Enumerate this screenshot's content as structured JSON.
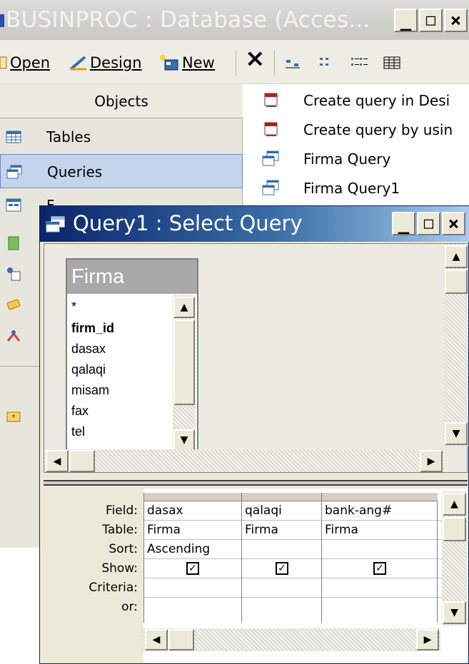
{
  "db_window": {
    "title": "BUSINPROC : Database (Acces...",
    "caption_buttons": [
      "_",
      "□",
      "×"
    ],
    "toolbar": {
      "open": "Open",
      "design": "Design",
      "new": "New",
      "delete_glyph": "×"
    },
    "objects_header": "Objects",
    "objects": [
      {
        "label": "Tables",
        "icon": "table-icon"
      },
      {
        "label": "Queries",
        "icon": "query-icon",
        "selected": true
      },
      {
        "label": "F",
        "icon": "form-icon"
      }
    ],
    "list": [
      {
        "label": "Create query in Desi",
        "icon": "wizard-icon"
      },
      {
        "label": "Create query by usin",
        "icon": "wizard-icon"
      },
      {
        "label": "Firma Query",
        "icon": "query-icon"
      },
      {
        "label": "Firma Query1",
        "icon": "query-icon"
      }
    ]
  },
  "query_window": {
    "title": "Query1 : Select Query",
    "caption_buttons": [
      "_",
      "□",
      "×"
    ],
    "table_box": {
      "name": "Firma",
      "fields": [
        "*",
        "firm_id",
        "dasax",
        "qalaqi",
        "misam",
        "fax",
        "tel"
      ],
      "bold_field": "firm_id"
    },
    "grid": {
      "row_labels": [
        "Field:",
        "Table:",
        "Sort:",
        "Show:",
        "Criteria:",
        "or:"
      ],
      "columns": [
        {
          "field": "dasax",
          "table": "Firma",
          "sort": "Ascending",
          "show": true
        },
        {
          "field": "qalaqi",
          "table": "Firma",
          "sort": "",
          "show": true
        },
        {
          "field": "bank-ang#",
          "table": "Firma",
          "sort": "",
          "show": true
        }
      ]
    },
    "scroll": {
      "up": "▲",
      "down": "▼",
      "left": "◀",
      "right": "▶"
    },
    "checkmark": "✓"
  }
}
